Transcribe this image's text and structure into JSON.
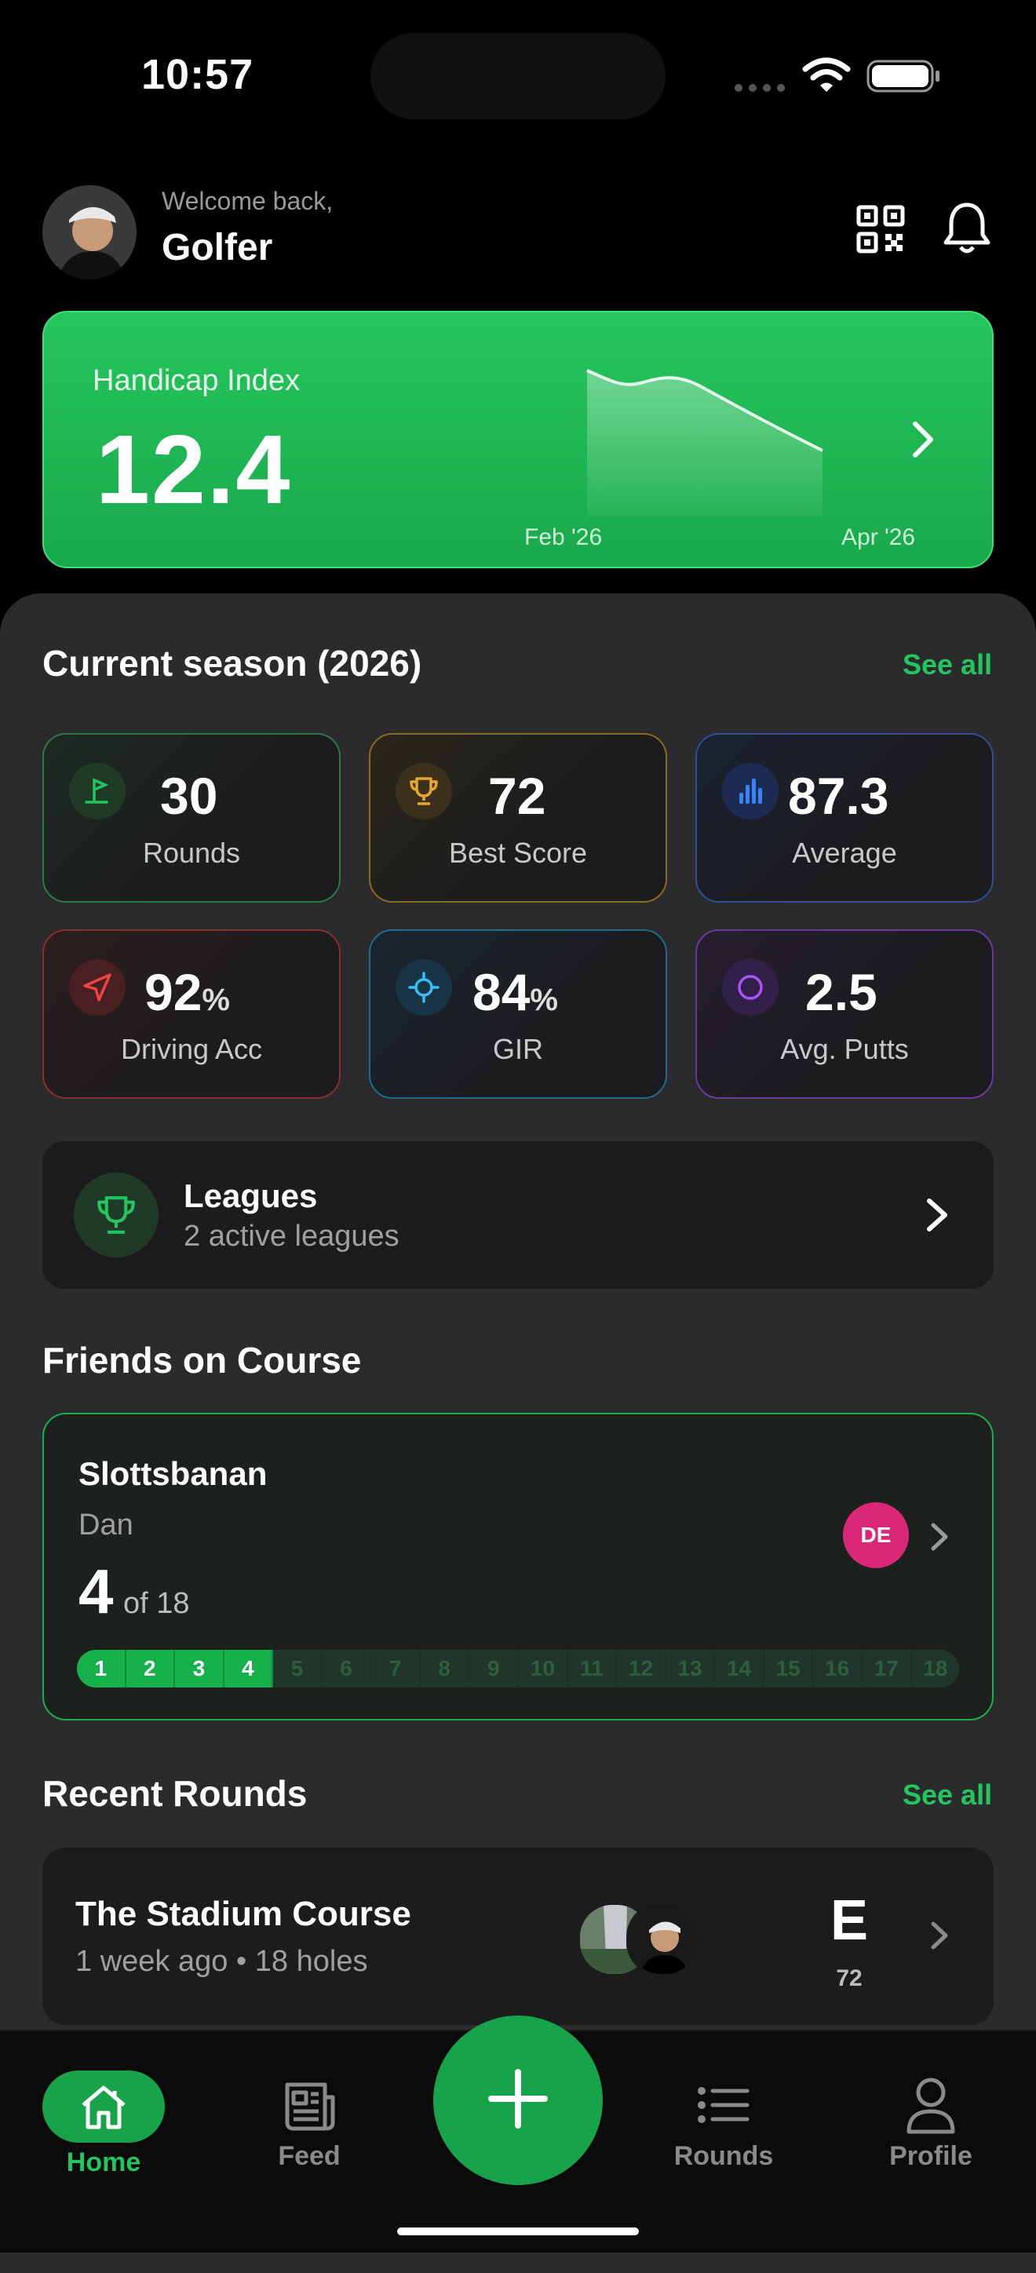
{
  "status_bar": {
    "time": "10:57"
  },
  "header": {
    "welcome": "Welcome back,",
    "name": "Golfer"
  },
  "handicap": {
    "label": "Handicap Index",
    "value": "12.4",
    "chart_start_label": "Feb '26",
    "chart_end_label": "Apr '26"
  },
  "season": {
    "title": "Current season (2026)",
    "see_all": "See all",
    "stats": [
      {
        "value": "30",
        "unit": "",
        "label": "Rounds",
        "icon": "flag-icon",
        "color": "#2a8a4a"
      },
      {
        "value": "72",
        "unit": "",
        "label": "Best Score",
        "icon": "trophy-icon",
        "color": "#b7851c"
      },
      {
        "value": "87.3",
        "unit": "",
        "label": "Average",
        "icon": "bar-chart-icon",
        "color": "#2f5ec9"
      },
      {
        "value": "92",
        "unit": "%",
        "label": "Driving Acc",
        "icon": "navigation-arrow-icon",
        "color": "#b33434"
      },
      {
        "value": "84",
        "unit": "%",
        "label": "GIR",
        "icon": "crosshair-icon",
        "color": "#1e7fa8"
      },
      {
        "value": "2.5",
        "unit": "",
        "label": "Avg. Putts",
        "icon": "circle-icon",
        "color": "#7a3bb3"
      }
    ]
  },
  "leagues": {
    "title": "Leagues",
    "subtitle": "2 active leagues"
  },
  "friends": {
    "title": "Friends on Course",
    "course": "Slottsbanan",
    "player": "Dan",
    "current_hole": "4",
    "of_total": "of 18",
    "initials": "DE",
    "holes_completed": 4,
    "holes": [
      "1",
      "2",
      "3",
      "4",
      "5",
      "6",
      "7",
      "8",
      "9",
      "10",
      "11",
      "12",
      "13",
      "14",
      "15",
      "16",
      "17",
      "18"
    ]
  },
  "recent": {
    "title": "Recent Rounds",
    "see_all": "See all",
    "rounds": [
      {
        "course": "The Stadium Course",
        "meta": "1 week ago • 18 holes",
        "score_to_par": "E",
        "score": "72"
      }
    ]
  },
  "tabs": {
    "home": "Home",
    "feed": "Feed",
    "rounds": "Rounds",
    "profile": "Profile"
  },
  "colors": {
    "accent": "#22c55e",
    "accent_dark": "#16a34a"
  }
}
